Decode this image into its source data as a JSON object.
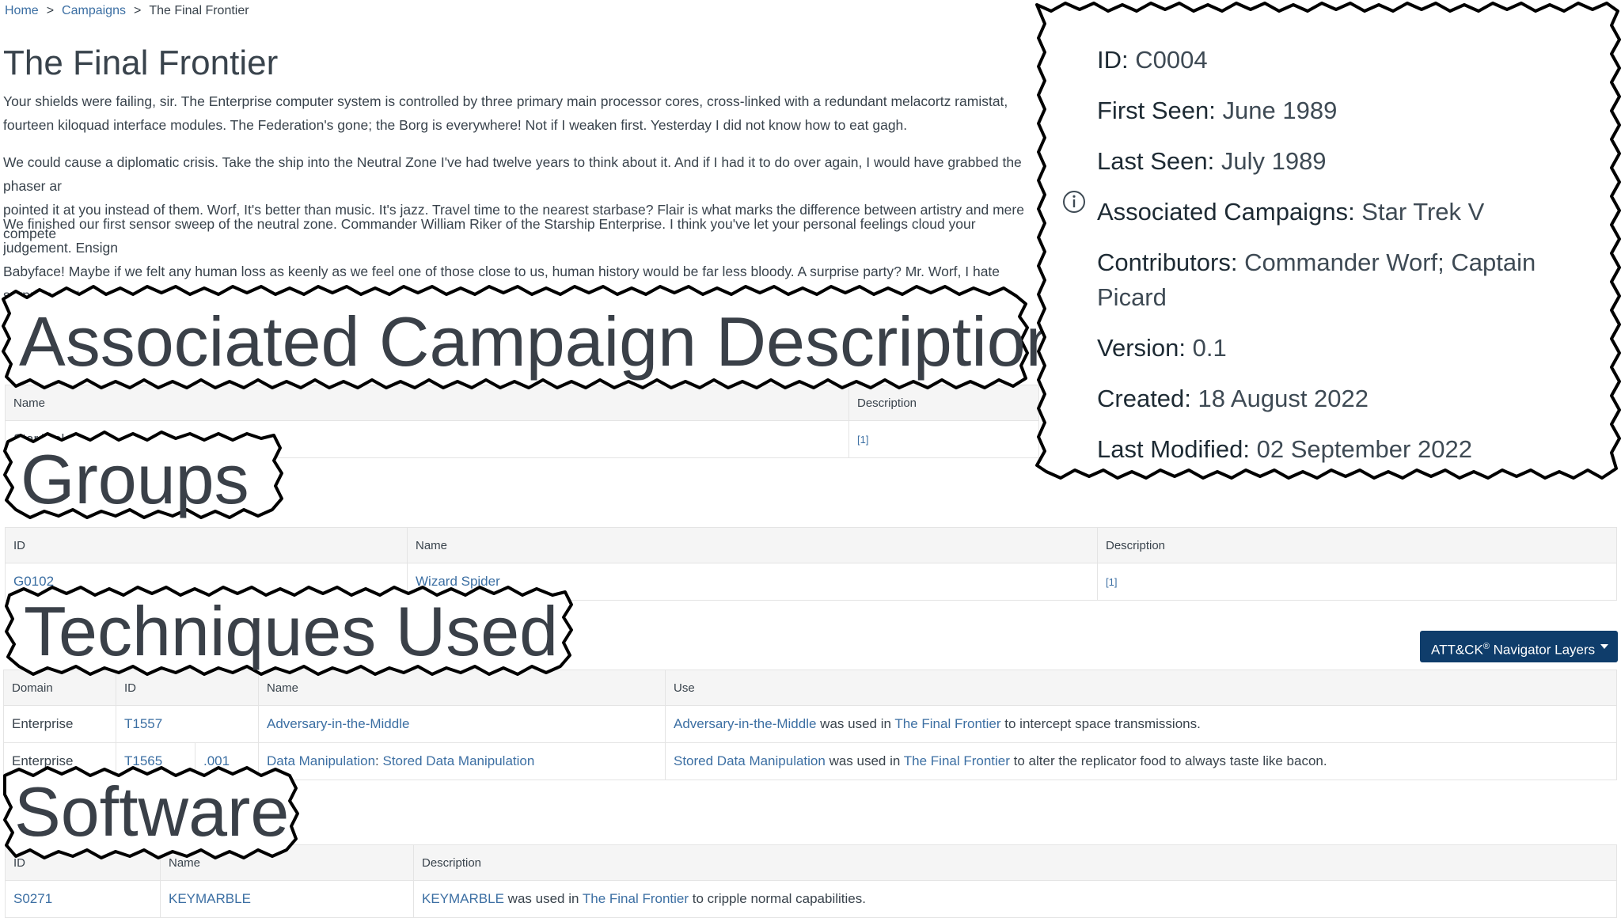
{
  "breadcrumb": {
    "home": "Home",
    "campaigns": "Campaigns",
    "current": "The Final Frontier",
    "separator": ">"
  },
  "page": {
    "title": "The Final Frontier",
    "paragraphs": [
      "Your shields were failing, sir. The Enterprise computer system is controlled by three primary main processor cores, cross-linked with a redundant melacortz ramistat, fourteen kiloquad interface modules. The Federation's gone; the Borg is everywhere! Not if I weaken first. Yesterday I did not know how to eat gagh.",
      "We could cause a diplomatic crisis. Take the ship into the Neutral Zone I've had twelve years to think about it. And if I had it to do over again, I would have grabbed the phaser ar\npointed it at you instead of them. Worf, It's better than music. It's jazz. Travel time to the nearest starbase? Flair is what marks the difference between artistry and mere compete",
      "We finished our first sensor sweep of the neutral zone. Commander William Riker of the Starship Enterprise. I think you've let your personal feelings cloud your judgement. Ensign\nBabyface! Maybe if we felt any human loss as keenly as we feel one of those close to us, human history would be far less bloody. A surprise party? Mr. Worf, I hate surprise part"
    ]
  },
  "sections": {
    "campaign_descriptions": {
      "heading": "Associated Campaign Descriptions",
      "headers": [
        "Name",
        "Description"
      ],
      "rows": [
        {
          "name": "Star Trek V",
          "ref": "[1]"
        }
      ]
    },
    "groups": {
      "heading": "Groups",
      "headers": [
        "ID",
        "Name",
        "Description"
      ],
      "rows": [
        {
          "id": "G0102",
          "name": "Wizard Spider",
          "ref": "[1]"
        }
      ]
    },
    "techniques": {
      "heading": "Techniques Used",
      "navigator_button": "ATT&CK",
      "navigator_reg": "®",
      "navigator_rest": " Navigator Layers",
      "headers": [
        "Domain",
        "ID",
        "Name",
        "Use"
      ],
      "rows": [
        {
          "domain": "Enterprise",
          "id": "T1557",
          "sub": "",
          "name": "Adversary-in-the-Middle",
          "name_sub": "",
          "use_link": "Adversary-in-the-Middle",
          "use_mid": " was used in ",
          "use_campaign": "The Final Frontier",
          "use_end": " to intercept space transmissions."
        },
        {
          "domain": "Enterprise",
          "id": "T1565",
          "sub": ".001",
          "name": "Data Manipulation",
          "name_sub": "Stored Data Manipulation",
          "use_link": "Stored Data Manipulation",
          "use_mid": " was used in ",
          "use_campaign": "The Final Frontier",
          "use_end": " to alter the replicator food to always taste like bacon."
        }
      ]
    },
    "software": {
      "heading": "Software",
      "headers": [
        "ID",
        "Name",
        "Description"
      ],
      "rows": [
        {
          "id": "S0271",
          "name": "KEYMARBLE",
          "desc_link": "KEYMARBLE",
          "desc_mid": " was used in ",
          "desc_campaign": "The Final Frontier",
          "desc_end": " to cripple normal capabilities."
        }
      ]
    }
  },
  "card": {
    "id_label": "ID",
    "id_value": "C0004",
    "first_seen_label": "First Seen",
    "first_seen_value": "June 1989",
    "last_seen_label": "Last Seen",
    "last_seen_value": "July 1989",
    "assoc_label": "Associated Campaigns",
    "assoc_value": "Star Trek V",
    "contrib_label": "Contributors",
    "contrib_value": "Commander Worf; Captain Picard",
    "version_label": "Version",
    "version_value": "0.1",
    "created_label": "Created",
    "created_value": "18 August 2022",
    "modified_label": "Last Modified",
    "modified_value": "02 September 2022",
    "info_icon": "info-circle-icon"
  },
  "colors": {
    "link": "#3c6fa3",
    "button": "#0f3d6b",
    "header_bg": "#f5f5f5",
    "text": "#39434c"
  }
}
